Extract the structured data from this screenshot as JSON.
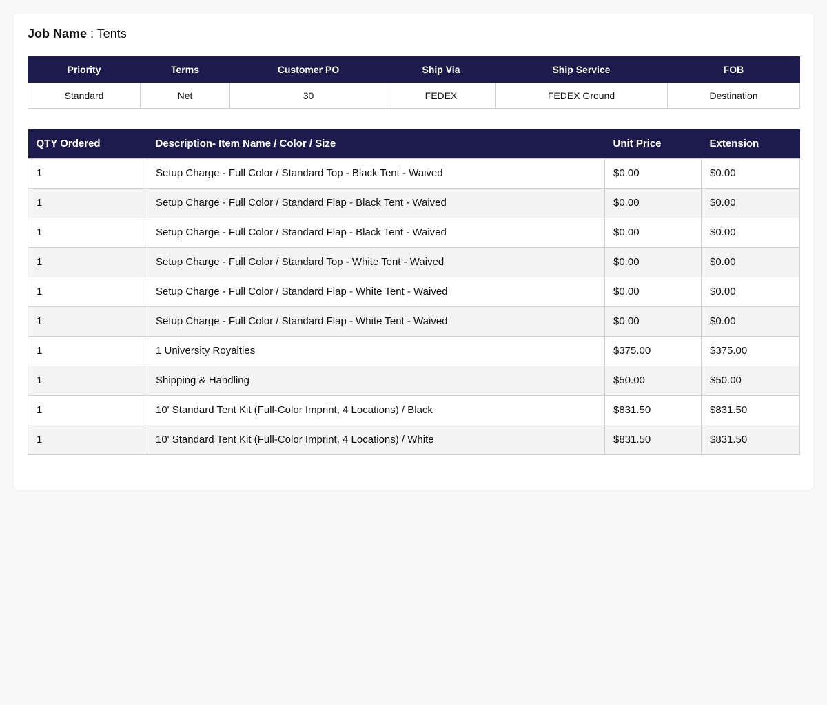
{
  "job": {
    "label": "Job Name",
    "separator": " : ",
    "value": "Tents"
  },
  "order_info": {
    "headers": [
      "Priority",
      "Terms",
      "Customer PO",
      "Ship Via",
      "Ship Service",
      "FOB"
    ],
    "values": [
      "Standard",
      "Net",
      "30",
      "FEDEX",
      "FEDEX Ground",
      "Destination"
    ]
  },
  "items": {
    "headers": [
      "QTY Ordered",
      "Description- Item Name / Color / Size",
      "Unit Price",
      "Extension"
    ],
    "rows": [
      {
        "qty": "1",
        "description": "Setup Charge - Full Color / Standard Top - Black Tent - Waived",
        "unit_price": "$0.00",
        "extension": "$0.00"
      },
      {
        "qty": "1",
        "description": "Setup Charge - Full Color / Standard Flap - Black Tent - Waived",
        "unit_price": "$0.00",
        "extension": "$0.00"
      },
      {
        "qty": "1",
        "description": "Setup Charge - Full Color / Standard Flap - Black Tent - Waived",
        "unit_price": "$0.00",
        "extension": "$0.00"
      },
      {
        "qty": "1",
        "description": "Setup Charge - Full Color / Standard Top - White Tent - Waived",
        "unit_price": "$0.00",
        "extension": "$0.00"
      },
      {
        "qty": "1",
        "description": "Setup Charge - Full Color / Standard Flap - White Tent - Waived",
        "unit_price": "$0.00",
        "extension": "$0.00"
      },
      {
        "qty": "1",
        "description": "Setup Charge - Full Color / Standard Flap - White Tent - Waived",
        "unit_price": "$0.00",
        "extension": "$0.00"
      },
      {
        "qty": "1",
        "description": "1 University Royalties",
        "unit_price": "$375.00",
        "extension": "$375.00"
      },
      {
        "qty": "1",
        "description": "Shipping & Handling",
        "unit_price": "$50.00",
        "extension": "$50.00"
      },
      {
        "qty": "1",
        "description": "10' Standard Tent Kit (Full-Color Imprint, 4 Locations) / Black",
        "unit_price": "$831.50",
        "extension": "$831.50"
      },
      {
        "qty": "1",
        "description": "10' Standard Tent Kit (Full-Color Imprint, 4 Locations) / White",
        "unit_price": "$831.50",
        "extension": "$831.50"
      }
    ]
  },
  "colors": {
    "header_bg": "#1c1b4b",
    "header_text": "#ffffff",
    "row_alt_bg": "#f4f4f4",
    "page_bg": "#f8f8f8"
  }
}
